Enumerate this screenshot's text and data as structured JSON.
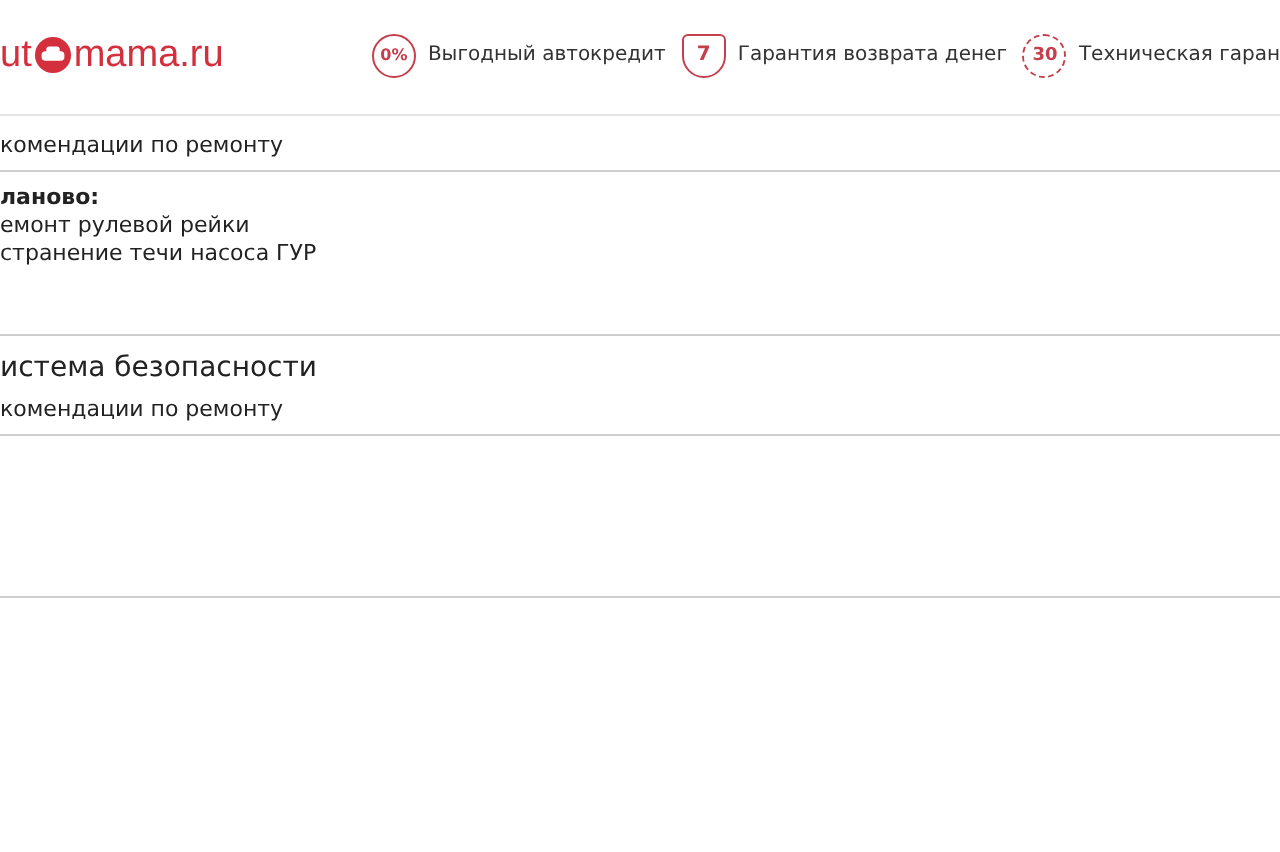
{
  "header": {
    "logo": {
      "before": "ut",
      "after": "mama.ru"
    },
    "features": [
      {
        "kind": "circle",
        "badge": "0%",
        "label": "Выгодный автокредит"
      },
      {
        "kind": "shield",
        "badge": "7",
        "label": "Гарантия возврата денег"
      },
      {
        "kind": "seal",
        "badge": "30",
        "label": "Техническая гаран"
      }
    ]
  },
  "sections": [
    {
      "subtitle": "комендации по ремонту",
      "planned": {
        "heading": "ланово:",
        "items": [
          "емонт рулевой рейки",
          "странение течи насоса ГУР"
        ]
      }
    },
    {
      "title": "истема безопасности",
      "subtitle": "комендации по ремонту"
    }
  ]
}
